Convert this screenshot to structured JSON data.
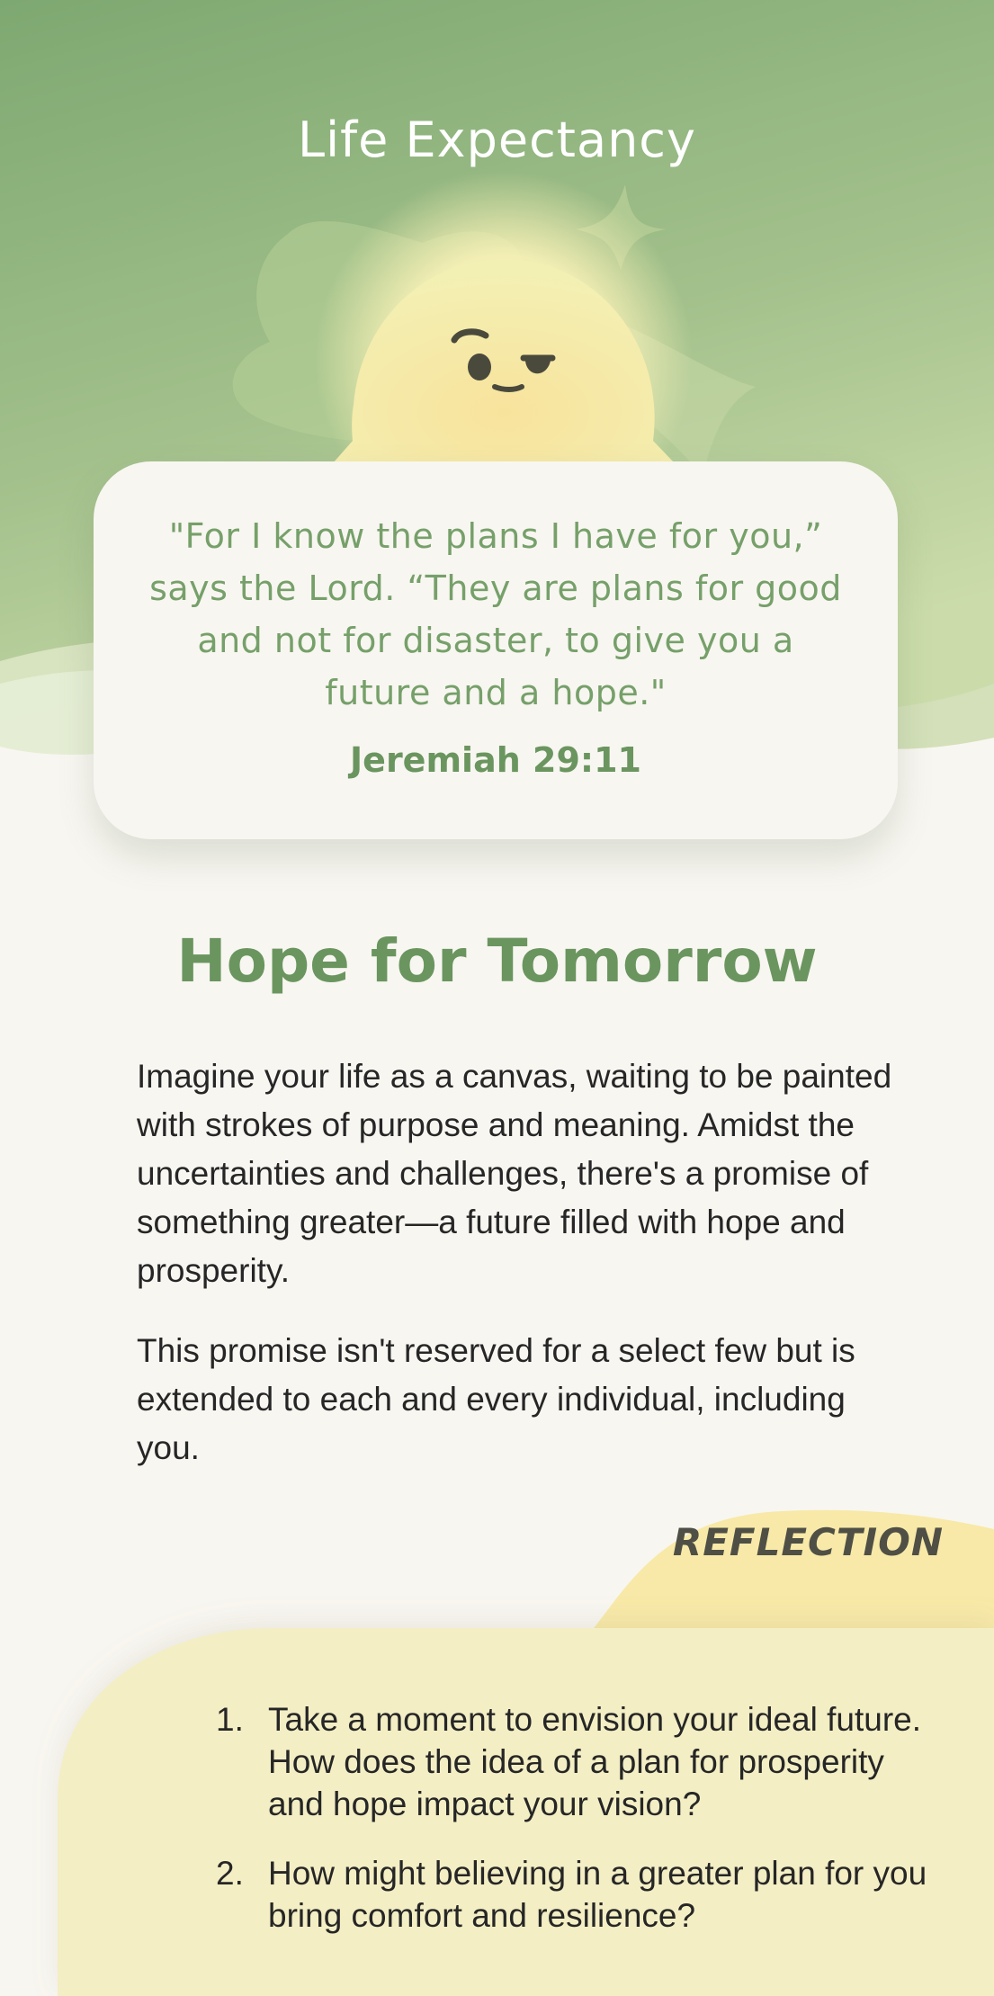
{
  "header": {
    "title": "Life Expectancy"
  },
  "quote": {
    "text": "\"For I know the plans I have for you,” says the Lord. “They are plans for good and not for disaster, to give you a future and a hope.\"",
    "reference": "Jeremiah 29:11"
  },
  "article": {
    "heading": "Hope for Tomorrow",
    "paragraphs": [
      "Imagine your life as a canvas, waiting to be painted with strokes of purpose and meaning. Amidst the uncertainties and challenges, there's a promise of something greater—a future filled with hope and prosperity.",
      "This promise isn't reserved for a select few but is extended to each and every individual, including you."
    ]
  },
  "reflection": {
    "label": "REFLECTION",
    "items": [
      {
        "number": "1.",
        "text": "Take a moment to envision your ideal future. How does the idea of a plan for prosperity and hope impact your vision?"
      },
      {
        "number": "2.",
        "text": "How might believing in a greater plan for you bring comfort and resilience?"
      }
    ]
  },
  "colors": {
    "hero_top": "#83ad76",
    "hero_bottom": "#c4d6a3",
    "sun": "#f3efaf",
    "sun_glow": "#f7e9a6",
    "accent_green": "#6a955f",
    "background": "#f8f6f1",
    "reflection_bg": "#f3eec4",
    "reflection_tab": "#f8e9a8"
  },
  "icons": {
    "mascot": "smirking-sun-icon",
    "sparkle": "sparkle-star-icon"
  }
}
